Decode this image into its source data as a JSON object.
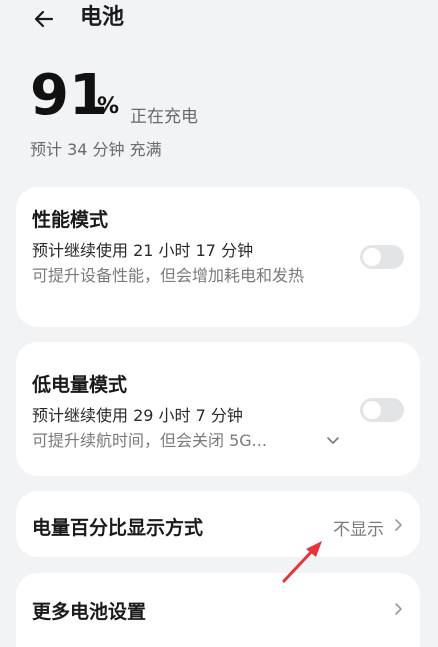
{
  "header": {
    "title": "电池"
  },
  "status": {
    "percent": "91",
    "percent_sign": "%",
    "charging_text": "正在充电",
    "estimate": "预计 34 分钟 充满"
  },
  "performance_mode": {
    "title": "性能模式",
    "subtitle": "预计继续使用 21 小时 17 分钟",
    "desc": "可提升设备性能，但会增加耗电和发热",
    "enabled": false
  },
  "low_power_mode": {
    "title": "低电量模式",
    "subtitle": "预计继续使用 29 小时 7 分钟",
    "desc": "可提升续航时间，但会关闭 5G...",
    "enabled": false
  },
  "percent_display": {
    "label": "电量百分比显示方式",
    "value": "不显示"
  },
  "more_settings": {
    "label": "更多电池设置"
  },
  "colors": {
    "background": "#f1f3f5",
    "card": "#ffffff",
    "annotation_arrow": "#e8323c"
  }
}
